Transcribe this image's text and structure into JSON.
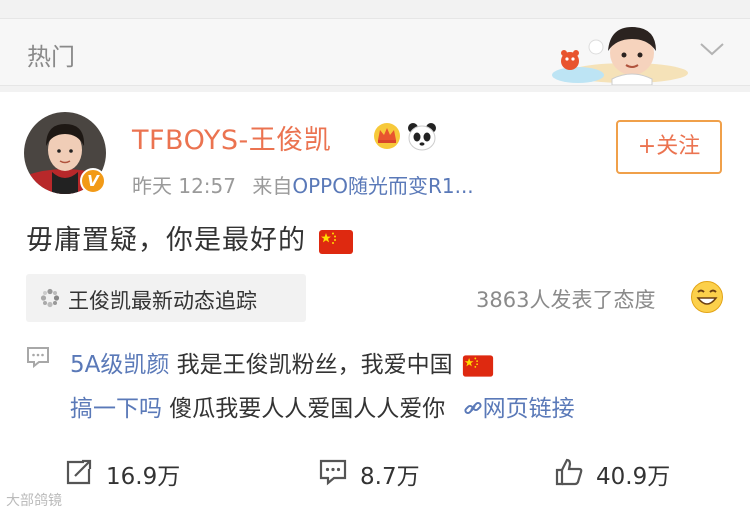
{
  "header": {
    "title": "热门"
  },
  "post": {
    "username": "TFBOYS-王俊凯",
    "verified_badge": "V",
    "timestamp": "昨天 12:57",
    "source_prefix": "来自",
    "source": "OPPO随光而变R1...",
    "follow_label": "+关注",
    "text": "毋庸置疑，你是最好的",
    "topic_label": "王俊凯最新动态追踪",
    "reactions_text": "3863人发表了态度"
  },
  "comments": [
    {
      "user": "5A级凯颜",
      "text": " 我是王俊凯粉丝，我爱中国"
    },
    {
      "user": "搞一下吗",
      "text": " 傻瓜我要人人爱国人人爱你",
      "link": "网页链接"
    }
  ],
  "actions": {
    "repost_count": "16.9万",
    "comment_count": "8.7万",
    "like_count": "40.9万"
  },
  "watermark": "大部鸽镜",
  "colors": {
    "accent": "#eb7350",
    "link": "#5a79b8",
    "badge": "#f29a17"
  },
  "icons": [
    "chevron-down-icon",
    "verified-icon",
    "crown-icon",
    "panda-icon",
    "flag-icon",
    "topic-icon",
    "smiley-icon",
    "comment-bubble-icon",
    "link-icon",
    "repost-icon",
    "comment-icon",
    "like-icon"
  ]
}
